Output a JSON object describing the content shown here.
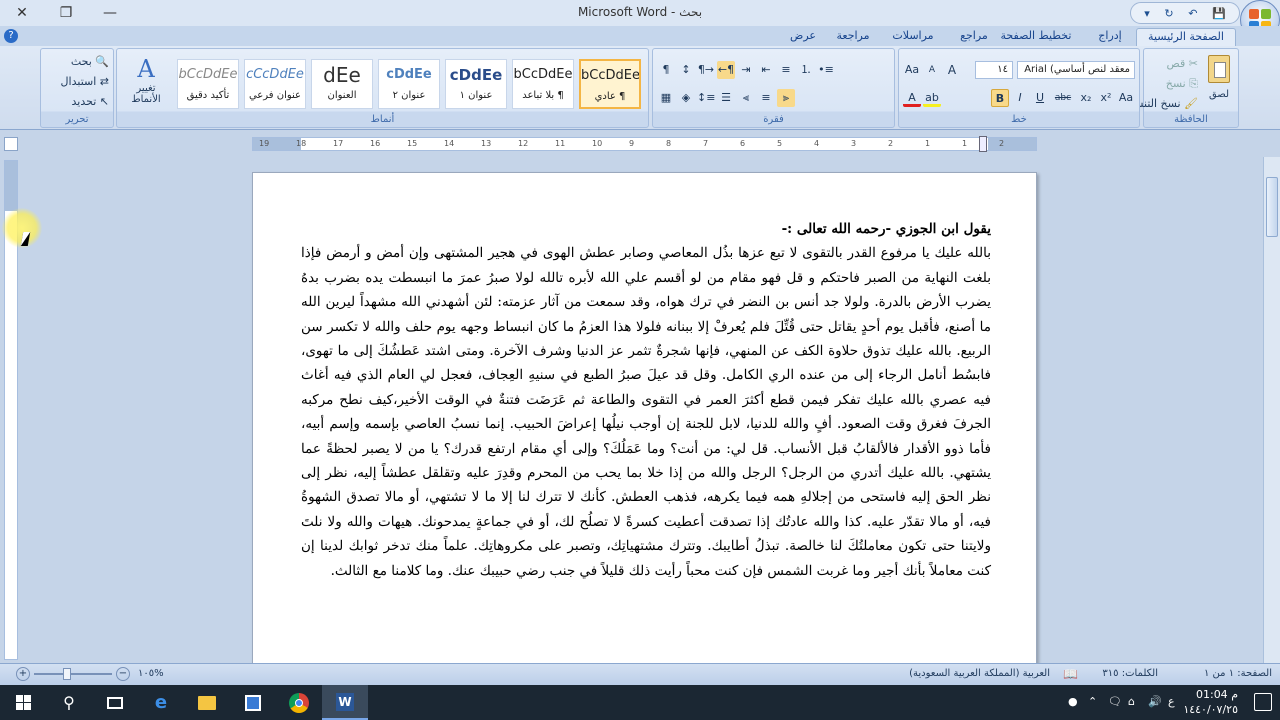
{
  "window": {
    "title": "بحث - Microsoft Word",
    "controls": {
      "close": "✕",
      "restore": "❐",
      "minimize": "—"
    }
  },
  "quick_access": {
    "save": "💾",
    "undo": "↶",
    "redo": "↻",
    "customize": "▾"
  },
  "tabs": [
    {
      "label": "الصفحة الرئيسية",
      "active": true
    },
    {
      "label": "إدراج"
    },
    {
      "label": "تخطيط الصفحة"
    },
    {
      "label": "مراجع"
    },
    {
      "label": "مراسلات"
    },
    {
      "label": "مراجعة"
    },
    {
      "label": "عرض"
    }
  ],
  "ribbon": {
    "clipboard": {
      "label": "الحافظة",
      "paste": "لصق",
      "cut": "قص",
      "copy": "نسخ",
      "format_painter": "نسخ التنسيق"
    },
    "font": {
      "label": "خط",
      "font_name": "معقد لنص أساسي) Arial",
      "font_size": "١٤",
      "bold": "B",
      "italic": "I",
      "underline": "U",
      "strike": "abc",
      "subscript": "x₂",
      "superscript": "x²",
      "change_case": "Aa",
      "grow": "A",
      "shrink": "A",
      "clear": "Aa",
      "font_color": "A",
      "highlight": "ab"
    },
    "paragraph": {
      "label": "فقرة"
    },
    "styles": {
      "label": "أنماط",
      "items": [
        {
          "sample": "bCcDdEe",
          "name": "¶ عادي",
          "selected": true
        },
        {
          "sample": "bCcDdEe",
          "name": "¶ بلا تباعد"
        },
        {
          "sample": "cDdEe",
          "name": "عنوان ١"
        },
        {
          "sample": "cDdEe",
          "name": "عنوان ٢"
        },
        {
          "sample": "dEe",
          "name": "العنوان"
        },
        {
          "sample": "cCcDdEe",
          "name": "عنوان فرعي"
        },
        {
          "sample": "bCcDdEe",
          "name": "تأكيد دقيق"
        }
      ],
      "change_styles": "تغيير الأنماط"
    },
    "editing": {
      "label": "تحرير",
      "find": "بحث",
      "replace": "استبدال",
      "select": "تحديد"
    }
  },
  "ruler": {
    "numbers": [
      "19",
      "18",
      "17",
      "16",
      "15",
      "14",
      "13",
      "12",
      "11",
      "10",
      "9",
      "8",
      "7",
      "6",
      "5",
      "4",
      "3",
      "2",
      "1",
      "1",
      "2"
    ]
  },
  "document": {
    "heading": "يقول ابن الجوزي -رحمه الله تعالى :-",
    "body": "بالله عليك يا مرفوع القدر بالتقوى لا تبع عزها بذُل المعاصي وصابر عطش الهوى في هجير المشتهى وإن أمض و أرمض فإذا بلغت النهاية من الصبر فاحتكم و قل فهو مقام من لو أقسم علي الله لأبره تالله لولا صبرُ عمرَ ما انبسطت يده بضرب بدهُ يضرب الأرض بالدرة. ولولا جد أنس بن النضر في ترك هواه، وقد سمعت من آثار عزمته: لئن أشهدني الله مشهداً ليرين الله ما أصنع، فأقبل يوم أحدٍ يقاتل حتى قُتِّلَ فلم يُعرفْ إلا ببنانه فلولا هذا العزمُ ما كان انبساط وجهه يوم حلف والله لا تكسر سن الربيع. بالله عليك تذوق حلاوة الكف عن المنهي، فإنها شجرةٌ تثمر عز الدنيا وشرف الآخرة. ومتى اشتد عَطشُكَ إلى ما تهوى، فابسُط أنامل الرجاء إلى من عنده الري الكامل. وقل قد عيلَ صبرُ الطبع في سنيهِ العِجاف، فعجل لي العام الذي فيه أغاث فيه عصري بالله عليك تفكر فيمن قطع أكثرَ العمر في التقوى والطاعة ثم عَرَضَت فتنةٌ في الوقت الأخير،كيف نطح مركبه الجرفَ فغرق وقت الصعود. أفٍ والله للدنيا، لابل للجنة إن أوجب نيلُها إعراضَ الحبيب. إنما نسبُ العاصي بإسمه وإسم أبيه، فأما ذوو الأقدار فالألقابُ قبل الأنساب. قل لي: من أنت؟ وما عَمَلُكَ؟ وإلى أي مقام ارتفع قدرك؟ يا من لا يصبر لحظةً عما يشتهي. بالله عليك أتدري من الرجل؟ الرجل والله من إذا خلا بما يحب من المحرم وقدِرَ عليه وتقلقل عطشاً إليه، نظر إلى نظر الحق إليه فاستحى من إجلالهِ همه فيما يكرهه، فذهب العطش. كأنك لا تترك لنا إلا ما لا تشتهي، أو مالا تصدق الشهوةُ فيه، أو مالا تقدّر عليه. كذا والله عادتُك إذا تصدقت أعطيت كسرةً لا تصلُح لك، أو في جماعةٍ يمدحونك. هيهات والله ولا نلتَ ولايتنا حتى تكون معاملتُكَ لنا خالصة. تبذلُ أطايبك. وتترك مشتهياتِك، وتصبر على مكروهاتِك. علماً منك تدخر ثوابك لدينا إن كنت معاملاً بأنك أجير وما غربت الشمس فإن كنت محباً رأيت ذلك قليلاً في جنب رضي حبيبك عنك. وما كلامنا مع الثالث."
  },
  "status": {
    "page": "الصفحة: ١ من ١",
    "words": "الكلمات: ٣١٥",
    "language": "العربية (المملكة العربية السعودية)",
    "zoom": "%١٠٥",
    "zoom_fraction": 0.42
  },
  "taskbar": {
    "time": "01:04 م",
    "date": "١٤٤٠/٠٧/٢٥",
    "lang": "ع"
  }
}
